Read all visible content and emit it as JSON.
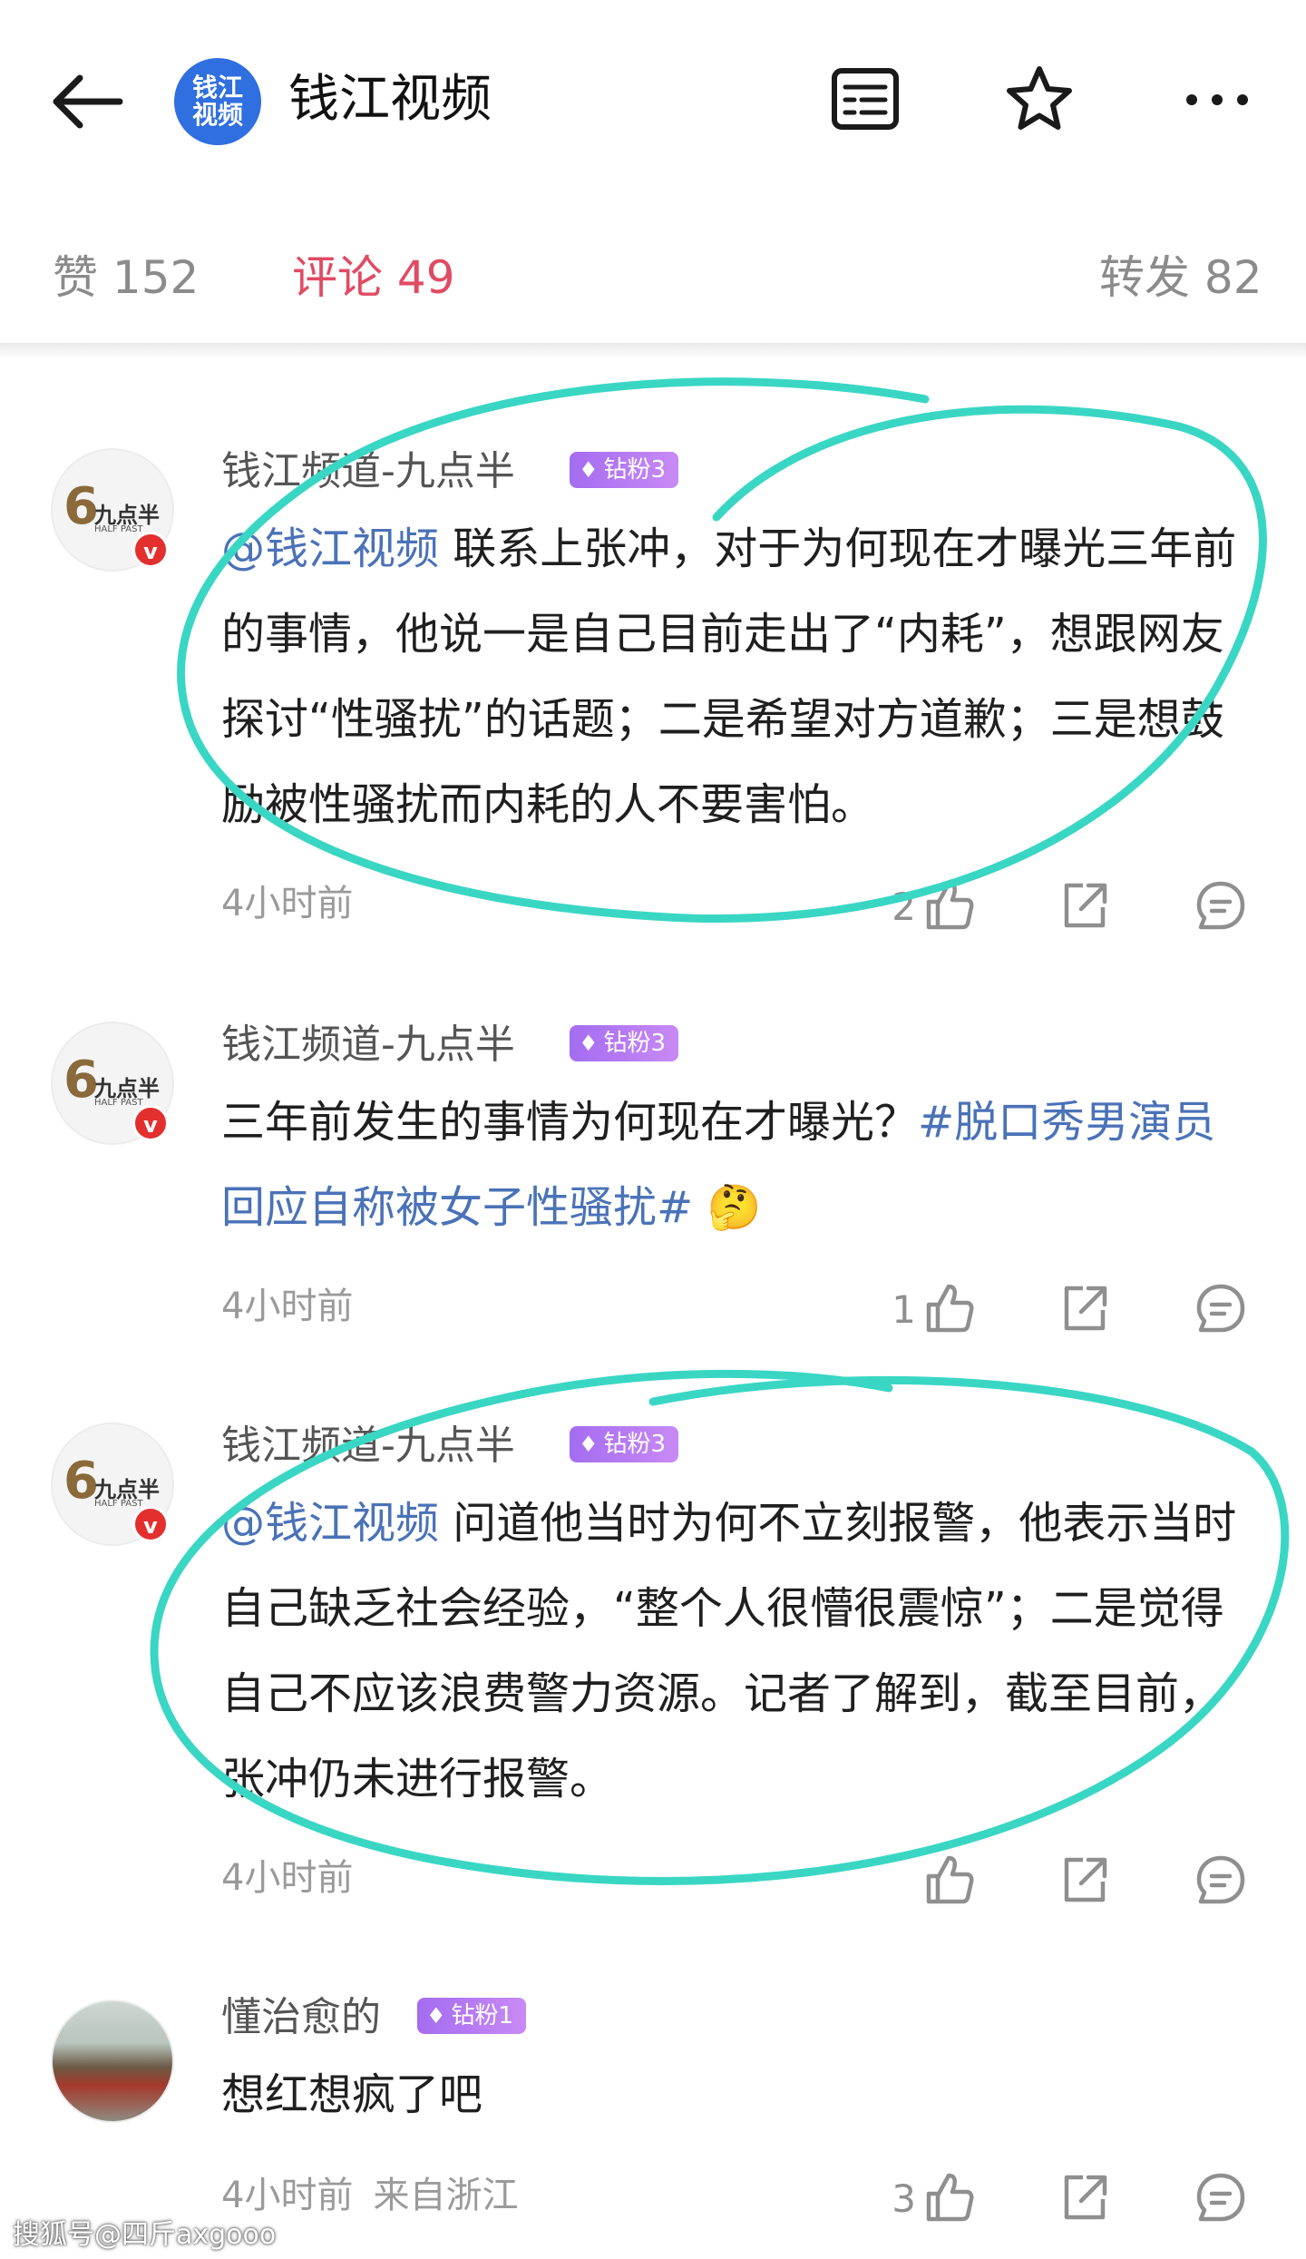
{
  "header": {
    "logo_text": "钱江\n视频",
    "title": "钱江视频"
  },
  "stats": {
    "likes": "赞 152",
    "comments": "评论 49",
    "reposts": "转发 82"
  },
  "comments": [
    {
      "username": "钱江频道-九点半",
      "badge": "钻粉3",
      "mention": "@钱江视频",
      "text": " 联系上张冲，对于为何现在才曝光三年前的事情，他说一是自己目前走出了“内耗”，想跟网友探讨“性骚扰”的话题；二是希望对方道歉；三是想鼓励被性骚扰而内耗的人不要害怕。",
      "time": "4小时前",
      "likes": "2",
      "verified": "v"
    },
    {
      "username": "钱江频道-九点半",
      "badge": "钻粉3",
      "text": "三年前发生的事情为何现在才曝光？",
      "hashtag": "#脱口秀男演员回应自称被女子性骚扰#",
      "emoji": "🤔",
      "time": "4小时前",
      "likes": "1",
      "verified": "v"
    },
    {
      "username": "钱江频道-九点半",
      "badge": "钻粉3",
      "mention": "@钱江视频",
      "text": " 问道他当时为何不立刻报警，他表示当时自己缺乏社会经验，“整个人很懵很震惊”；二是觉得自己不应该浪费警力资源。记者了解到，截至目前，张冲仍未进行报警。",
      "time": "4小时前",
      "likes": "",
      "verified": "v"
    },
    {
      "username": "懂治愈的",
      "badge": "钻粉1",
      "text": "想红想疯了吧",
      "time": "4小时前",
      "location": "来自浙江",
      "likes": "3"
    }
  ],
  "avatar_logo": {
    "numeral": "6",
    "name": "九点半",
    "sub": "HALF PAST"
  },
  "watermark": "搜狐号@四斤axgooo",
  "colors": {
    "accent": "#e14b63",
    "link": "#4a72b8",
    "badge": "#a46cf0",
    "highlight_circle": "#3ad6c4"
  }
}
